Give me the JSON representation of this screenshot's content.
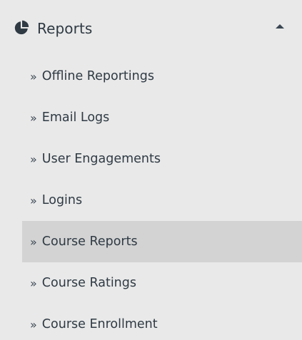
{
  "menu": {
    "section": {
      "label": "Reports",
      "icon": "pie-chart-icon",
      "expanded_indicator": "caret-up-icon"
    },
    "bullet": "»",
    "items": [
      {
        "label": "Offline Reportings"
      },
      {
        "label": "Email Logs"
      },
      {
        "label": "User Engagements"
      },
      {
        "label": "Logins"
      },
      {
        "label": "Course Reports",
        "active": true
      },
      {
        "label": "Course Ratings"
      },
      {
        "label": "Course Enrollment"
      }
    ]
  },
  "colors": {
    "background": "#e9e9e9",
    "active_background": "#d3d3d3",
    "text": "#2f3a44"
  }
}
